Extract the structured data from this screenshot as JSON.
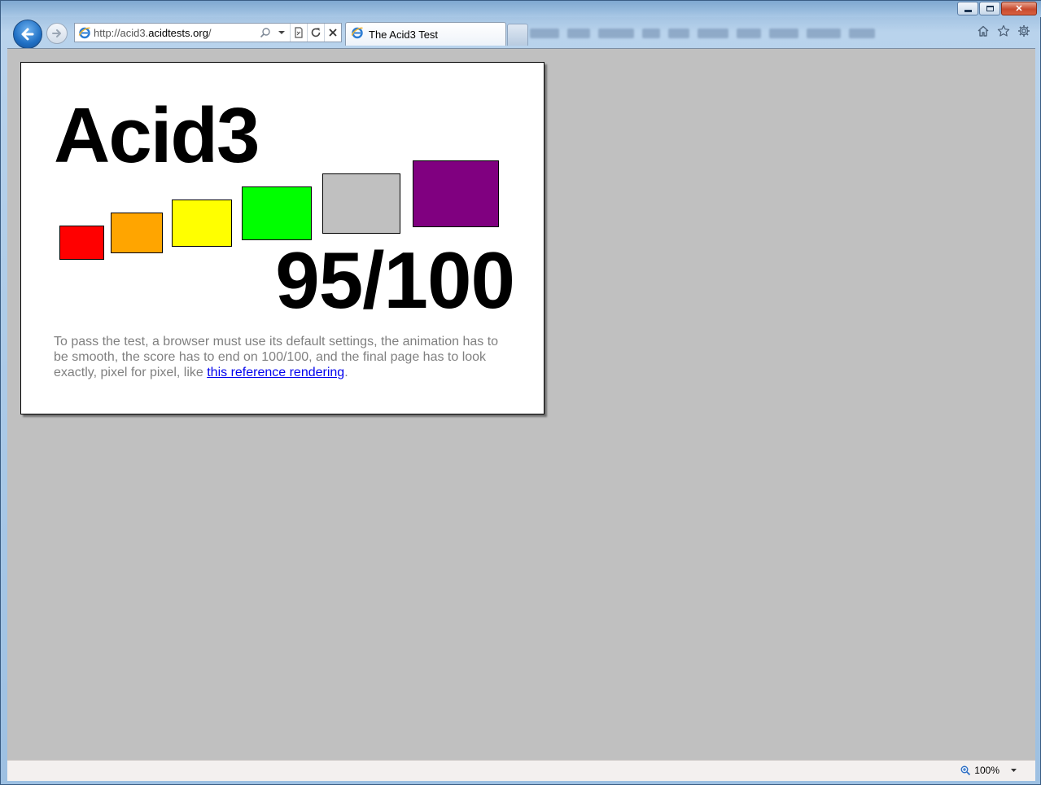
{
  "window": {
    "caption_buttons": {
      "minimize": "",
      "maximize": "",
      "close": "✕"
    }
  },
  "toolbar": {
    "address_url_prefix": "http://acid3.",
    "address_url_host": "acidtests.org",
    "address_url_suffix": "/",
    "tab_title": "The Acid3 Test",
    "icons": [
      "back-arrow-icon",
      "forward-arrow-icon",
      "ie-logo-icon",
      "search-icon",
      "dropdown-arrow-icon",
      "compat-view-icon",
      "refresh-icon",
      "stop-icon",
      "home-icon",
      "favorites-star-icon",
      "gear-icon"
    ]
  },
  "page": {
    "title": "Acid3",
    "score": "95/100",
    "description_text": "To pass the test, a browser must use its default settings, the animation has to be smooth, the score has to end on 100/100, and the final page has to look exactly, pixel for pixel, like ",
    "link_text": "this reference rendering",
    "description_end": ".",
    "squares": [
      {
        "name": "red",
        "color": "#ff0000"
      },
      {
        "name": "orange",
        "color": "#ffa500"
      },
      {
        "name": "yellow",
        "color": "#ffff00"
      },
      {
        "name": "lime",
        "color": "#00ff00"
      },
      {
        "name": "silver",
        "color": "#c0c0c0"
      },
      {
        "name": "purple",
        "color": "#800080"
      }
    ]
  },
  "statusbar": {
    "zoom_level": "100%"
  },
  "colors": {
    "viewport_bg": "#c0c0c0",
    "link": "#0000ee",
    "description": "#808080"
  }
}
